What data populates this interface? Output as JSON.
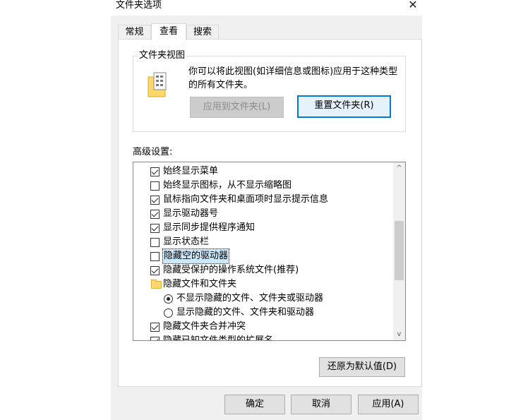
{
  "window": {
    "title": "文件夹选项",
    "close_glyph": "✕"
  },
  "tabs": [
    {
      "label": "常规",
      "active": false
    },
    {
      "label": "查看",
      "active": true
    },
    {
      "label": "搜索",
      "active": false
    }
  ],
  "folder_view": {
    "legend": "文件夹视图",
    "description": "你可以将此视图(如详细信息或图标)应用于这种类型的所有文件夹。",
    "apply_button": "应用到文件夹(L)",
    "reset_button": "重置文件夹(R)"
  },
  "advanced": {
    "label": "高级设置:",
    "items": [
      {
        "type": "checkbox",
        "checked": true,
        "label": "始终显示菜单"
      },
      {
        "type": "checkbox",
        "checked": false,
        "label": "始终显示图标，从不显示缩略图"
      },
      {
        "type": "checkbox",
        "checked": true,
        "label": "鼠标指向文件夹和桌面项时显示提示信息"
      },
      {
        "type": "checkbox",
        "checked": true,
        "label": "显示驱动器号"
      },
      {
        "type": "checkbox",
        "checked": true,
        "label": "显示同步提供程序通知"
      },
      {
        "type": "checkbox",
        "checked": false,
        "label": "显示状态栏"
      },
      {
        "type": "checkbox",
        "checked": false,
        "label": "隐藏空的驱动器",
        "focused": true
      },
      {
        "type": "checkbox",
        "checked": true,
        "label": "隐藏受保护的操作系统文件(推荐)"
      },
      {
        "type": "folder",
        "label": "隐藏文件和文件夹"
      },
      {
        "type": "radio",
        "checked": true,
        "label": "不显示隐藏的文件、文件夹或驱动器",
        "indent": true
      },
      {
        "type": "radio",
        "checked": false,
        "label": "显示隐藏的文件、文件夹和驱动器",
        "indent": true
      },
      {
        "type": "checkbox",
        "checked": true,
        "label": "隐藏文件夹合并冲突"
      },
      {
        "type": "checkbox",
        "checked": true,
        "label": "隐藏已知文件类型的扩展名"
      }
    ],
    "scroll_up_glyph": "^",
    "scroll_down_glyph": "v"
  },
  "restore_defaults_button": "还原为默认值(D)",
  "footer": {
    "ok": "确定",
    "cancel": "取消",
    "apply": "应用(A)"
  }
}
